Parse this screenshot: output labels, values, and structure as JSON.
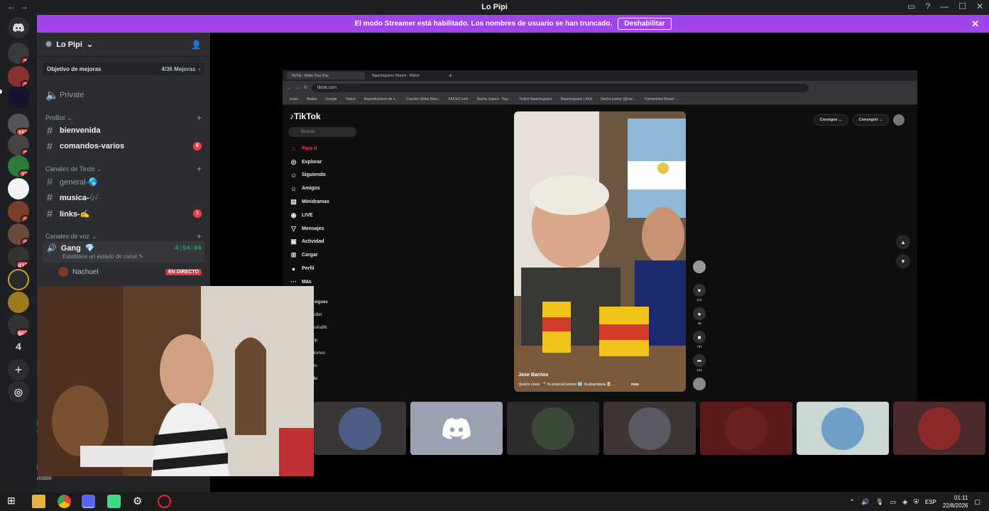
{
  "window": {
    "title": "Lo Pipi"
  },
  "banner": {
    "message": "El modo Streamer está habilitado. Los nombres de usuario se han truncado.",
    "button": "Deshabilitar"
  },
  "rail": {
    "badges": [
      "1",
      "7",
      "152",
      "3",
      "17",
      "3",
      "3",
      "413",
      "807"
    ],
    "folder_count": "4"
  },
  "server": {
    "name": "Lo Pipi"
  },
  "boost": {
    "label": "Objetivo de mejoras",
    "progress": "4/36 Mejoras"
  },
  "channels": {
    "private": "Private",
    "probot": {
      "category": "ProBot",
      "items": [
        {
          "name": "bienvenida"
        },
        {
          "name": "comandos-varios",
          "badge": "6"
        }
      ]
    },
    "text": {
      "category": "Canales de Texto",
      "items": [
        {
          "name": "general-🌎"
        },
        {
          "name": "musica-🎶"
        },
        {
          "name": "links-✍",
          "badge": "1"
        }
      ]
    },
    "voice": {
      "category": "Canales de voz",
      "channel": "Gang",
      "emoji": "💎",
      "timer": "4:54:06",
      "status_placeholder": "Establece un estado de canal"
    },
    "member": {
      "name": "Nachuel",
      "live": "EN DIRECTO"
    }
  },
  "user_panel": {
    "voice_label": "Vo",
    "voice_sub": "Ga",
    "username": "Kl",
    "status": "Invisible"
  },
  "stream": {
    "tabs": [
      "TikTok - Make Your Day",
      "Naachoguanz Stream - Watch"
    ],
    "url": "tiktok.com",
    "bookmarks": [
      "Icons",
      "Redes",
      "Google",
      "Twitch",
      "Reproductores de v...",
      "Counter-Strike New...",
      "FACEIT.com",
      "Nacho Juarez - You...",
      "Twitch Naachoguanz",
      "Naachoguanz | Kick",
      "Nacho juarez (@nac...",
      "Comunidad Steam :..."
    ],
    "tiktok": {
      "logo": "TikTok",
      "search": "Buscar",
      "nav": [
        "Para ti",
        "Explorar",
        "Siguiendo",
        "Amigos",
        "Minidramas",
        "LIVE",
        "Mensajes",
        "Actividad",
        "Cargar",
        "Perfil",
        "Más"
      ],
      "following_title": "ue sigues",
      "following": [
        "oMüller",
        "nasoria96",
        "n trip",
        "o Hornos",
        "ldein",
        "todo"
      ],
      "top_buttons": [
        "Consigue ...",
        "Conseguir ..."
      ],
      "video": {
        "author": "Jose Barrios",
        "caption": "Quiero creer 🎤 #LucianoCreimer 🔤 #Labandaria 🍺 ...",
        "more": "más"
      },
      "actions": {
        "likes": "11K",
        "comments": "45",
        "saves": "737",
        "shares": "441"
      }
    }
  },
  "taskbar": {
    "lang": "ESP",
    "time": "01:11",
    "date": "22/8/2026"
  }
}
